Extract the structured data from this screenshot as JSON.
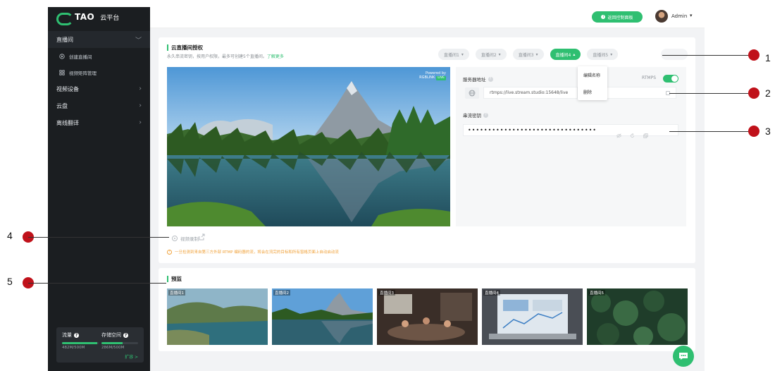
{
  "brand": {
    "name": "TAO",
    "sub": "云平台"
  },
  "sidebar": {
    "items": [
      {
        "label": "直播间",
        "active": true,
        "chevron": "﹀"
      },
      {
        "label": "创建直播间",
        "sub": true,
        "icon": "play-circle-icon"
      },
      {
        "label": "视频矩阵管理",
        "sub": true,
        "icon": "grid-icon"
      },
      {
        "label": "视频设备",
        "chevron": "›"
      },
      {
        "label": "云盘",
        "chevron": "›"
      },
      {
        "label": "离线翻译",
        "chevron": "›"
      }
    ],
    "usage": {
      "traffic_label": "流量",
      "traffic_value": "482M/500M",
      "traffic_fraction": 0.96,
      "storage_label": "存储空间",
      "storage_value": "286M/500M",
      "storage_fraction": 0.57,
      "expand_label": "扩容 >"
    }
  },
  "topbar": {
    "console_label": "返回控制面板",
    "user_name": "Admin",
    "caret": "▾"
  },
  "live": {
    "title": "云直播间授权",
    "subtitle": "永久串流密钥，按用户权限，最多可创建5个直播间。",
    "learn_more": "了解更多",
    "tabs": [
      {
        "label": "直播间1",
        "caret": "▾"
      },
      {
        "label": "直播间2",
        "caret": "▾"
      },
      {
        "label": "直播间3",
        "caret": "▾"
      },
      {
        "label": "直播间4",
        "caret": "▴",
        "active": true
      },
      {
        "label": "直播间5",
        "caret": "▾"
      }
    ],
    "menu": {
      "rename": "编辑名称",
      "delete": "删除"
    },
    "powered_by": "Powered by",
    "powered_brand": "RGBLINK",
    "powered_badge": "LIVE",
    "server": {
      "label": "服务器地址",
      "protocol_label": "RTMPS",
      "value": "rtmps://live.stream.studio:15648/live"
    },
    "key": {
      "label": "串流密钥",
      "value": "••••••••••••••••••••••••••••••••"
    },
    "record_label": "视频录制",
    "warning": "一旦检测到来自第三方外部 RTMP 编码器的流，将会在流完的目标和所有窗格页面上自动启动流"
  },
  "monitor": {
    "title": "预监",
    "thumbs": [
      "直播间1",
      "直播间2",
      "直播间3",
      "直播间4",
      "直播间5"
    ]
  },
  "callouts": [
    "1",
    "2",
    "3",
    "4",
    "5"
  ],
  "colors": {
    "accent": "#2fbf71",
    "sidebar": "#1b1e21",
    "callout": "#c0111a"
  }
}
